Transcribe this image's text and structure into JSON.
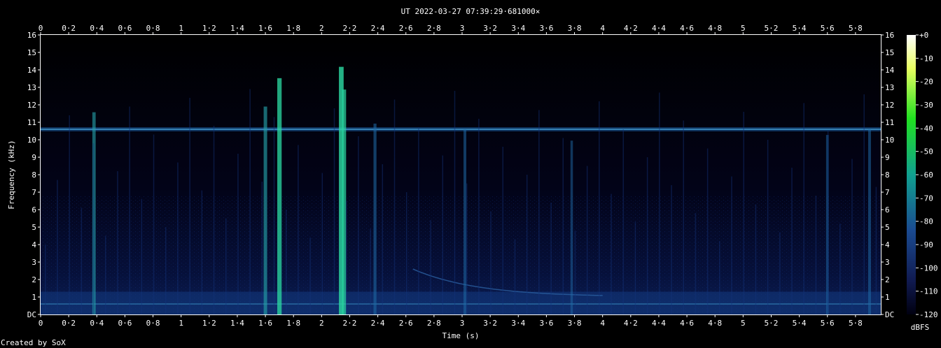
{
  "chart_data": {
    "type": "heatmap",
    "title": "UT 2022-03-27 07:39:29·681000×",
    "xlabel": "Time (s)",
    "ylabel": "Frequency (kHz)",
    "xlim": [
      0,
      5.98
    ],
    "ylim": [
      0,
      16
    ],
    "x_ticks": [
      "0",
      "0·2",
      "0·4",
      "0·6",
      "0·8",
      "1",
      "1·2",
      "1·4",
      "1·6",
      "1·8",
      "2",
      "2·2",
      "2·4",
      "2·6",
      "2·8",
      "3",
      "3·2",
      "3·4",
      "3·6",
      "3·8",
      "4",
      "4·2",
      "4·4",
      "4·6",
      "4·8",
      "5",
      "5·2",
      "5·4",
      "5·6",
      "5·8"
    ],
    "x_tick_values": [
      0,
      0.2,
      0.4,
      0.6,
      0.8,
      1,
      1.2,
      1.4,
      1.6,
      1.8,
      2,
      2.2,
      2.4,
      2.6,
      2.8,
      3,
      3.2,
      3.4,
      3.6,
      3.8,
      4,
      4.2,
      4.4,
      4.6,
      4.8,
      5,
      5.2,
      5.4,
      5.6,
      5.8
    ],
    "y_ticks": [
      "DC",
      "1",
      "2",
      "3",
      "4",
      "5",
      "6",
      "7",
      "8",
      "9",
      "10",
      "11",
      "12",
      "13",
      "14",
      "15",
      "16"
    ],
    "y_tick_values": [
      0,
      1,
      2,
      3,
      4,
      5,
      6,
      7,
      8,
      9,
      10,
      11,
      12,
      13,
      14,
      15,
      16
    ],
    "colorbar": {
      "label": "dBFS",
      "ticks": [
        "+0",
        "-10",
        "-20",
        "-30",
        "-40",
        "-50",
        "-60",
        "-70",
        "-80",
        "-90",
        "-100",
        "-110",
        "-120"
      ],
      "range": [
        -120,
        0
      ]
    },
    "features": {
      "tone_khz": 10.6,
      "low_tone_khz": 0.6,
      "impulses_s": [
        0.38,
        1.6,
        1.7,
        2.14,
        2.16,
        2.38,
        3.02,
        3.78,
        5.6,
        5.9
      ],
      "impulse_strength": [
        0.55,
        0.6,
        0.85,
        0.95,
        0.75,
        0.45,
        0.4,
        0.3,
        0.35,
        0.4
      ]
    },
    "colors": {
      "background": "#000000",
      "low": "#0a0f3a",
      "mid": "#1a6aa0",
      "high": "#2ad6a0"
    }
  },
  "credit": "Created by SoX"
}
